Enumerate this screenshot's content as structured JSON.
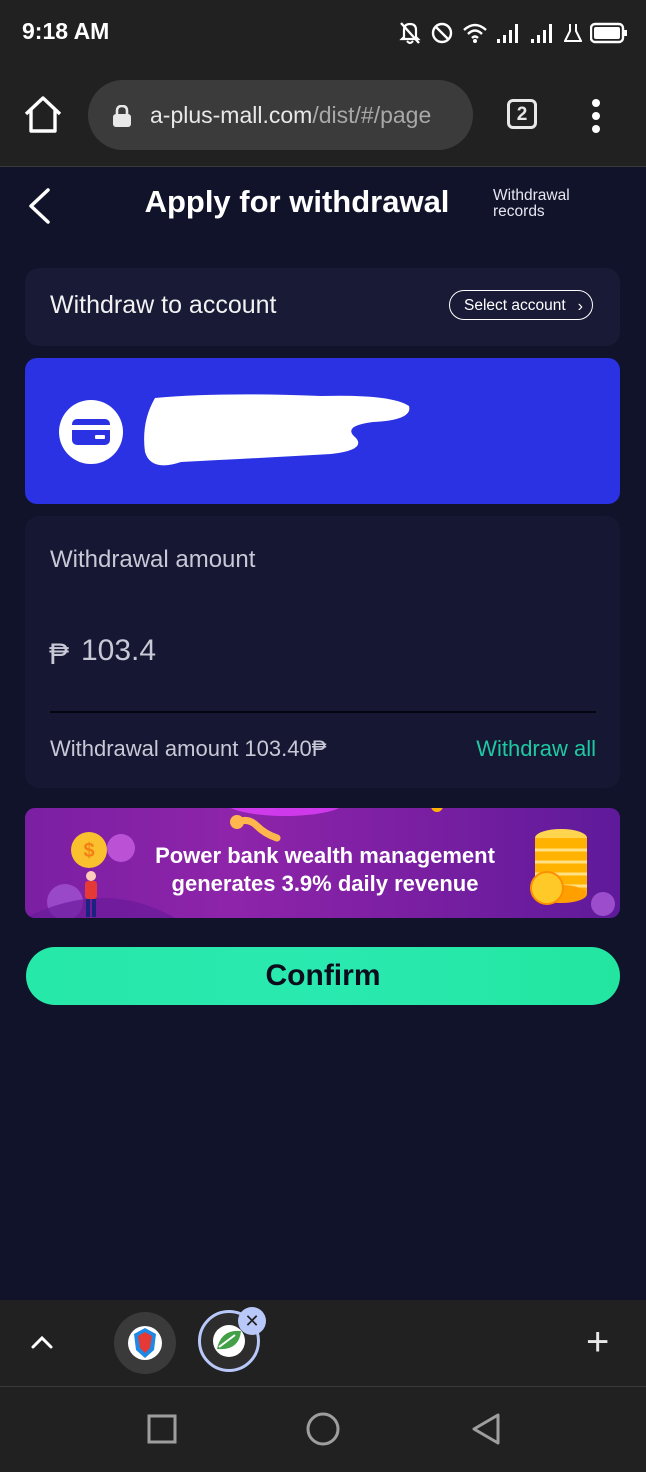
{
  "status_bar": {
    "time": "9:18 AM"
  },
  "browser": {
    "url_domain": "a-plus-mall.com",
    "url_path": "/dist/#/page",
    "tab_count": "2",
    "new_tab": "+"
  },
  "header": {
    "title": "Apply for withdrawal",
    "records_link": "Withdrawal records"
  },
  "account": {
    "label": "Withdraw to account",
    "select_button": "Select account"
  },
  "amount": {
    "label": "Withdrawal amount",
    "currency_symbol": "₱",
    "value": "103.4",
    "available_text": "Withdrawal amount 103.40₱",
    "withdraw_all": "Withdraw all"
  },
  "banner": {
    "line1": "Power bank wealth management",
    "line2": "generates 3.9% daily revenue"
  },
  "confirm_label": "Confirm",
  "colors": {
    "page_bg": "#11132b",
    "card_bg": "#181a36",
    "bank_card": "#2b32e3",
    "accent_green": "#1ec9a2",
    "confirm_button": "#2ae9b0"
  }
}
